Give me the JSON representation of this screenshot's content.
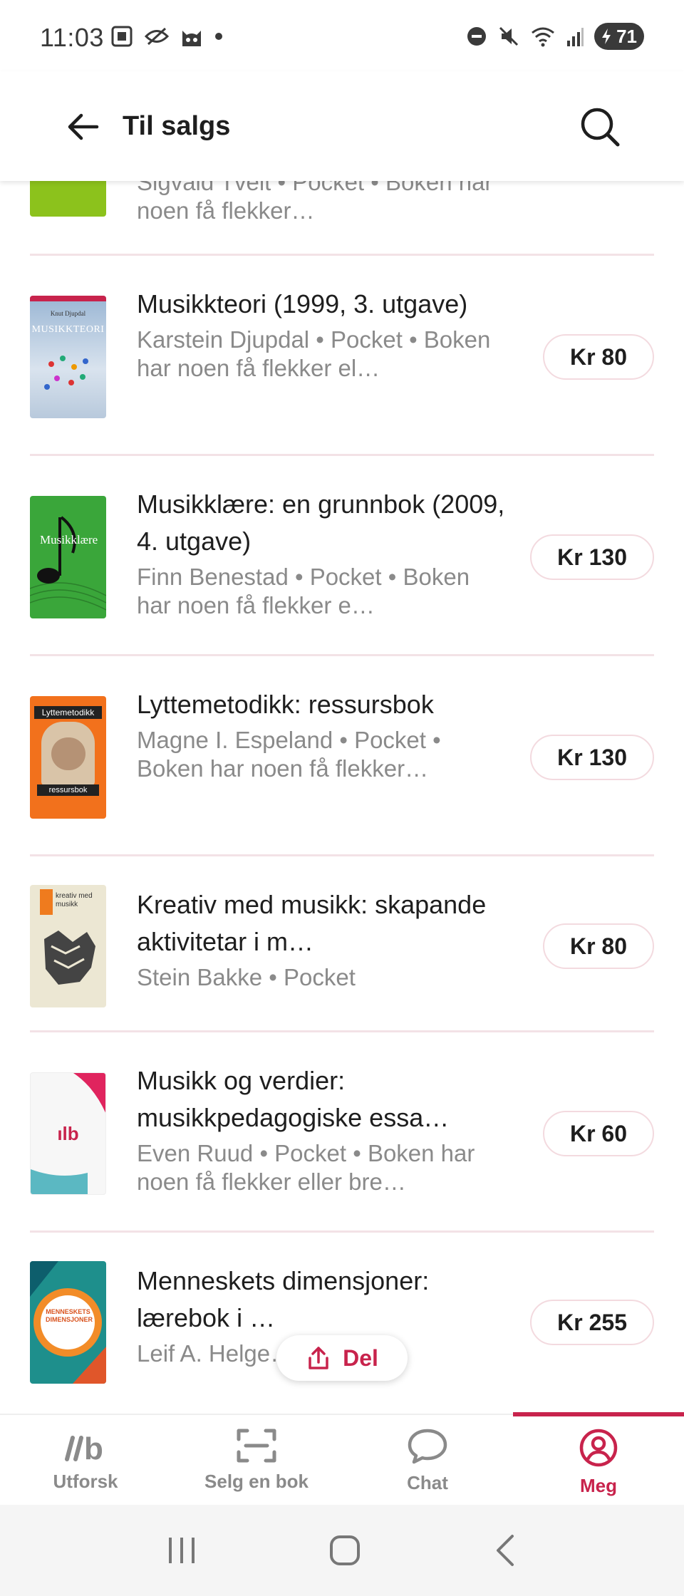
{
  "status_bar": {
    "time": "11:03",
    "battery": "71",
    "left_icons": [
      "screenshot-icon",
      "eye-off-icon",
      "cat-icon",
      "dot-icon"
    ],
    "right_icons": [
      "do-not-disturb-icon",
      "mute-icon",
      "wifi-icon",
      "signal-icon",
      "battery-icon"
    ]
  },
  "header": {
    "title": "Til salgs"
  },
  "colors": {
    "accent": "#c8234c",
    "divider": "#f3e2e6",
    "muted_text": "#8a8a8a"
  },
  "books": [
    {
      "title": "",
      "subtitle": "Sigvald Tveit • Pocket • Boken har noen få flekker…",
      "price": "",
      "cover_color": "#8cc21c"
    },
    {
      "title": "Musikkteori (1999, 3. utgave)",
      "subtitle": "Karstein Djupdal • Pocket • Boken har noen få flekker el…",
      "price": "Kr 80",
      "cover_color": "#c9d6e3",
      "cover_text": "MUSIKKTEORI",
      "cover_author": "Knut Djupdal"
    },
    {
      "title": "Musikklære: en grunnbok (2009, 4. utgave)",
      "subtitle": "Finn Benestad • Pocket • Boken har noen få flekker e…",
      "price": "Kr 130",
      "cover_color": "#3aa63a",
      "cover_text": "Musikklære"
    },
    {
      "title": "Lyttemetodikk: ressursbok",
      "subtitle": "Magne I. Espeland • Pocket • Boken har noen få flekker…",
      "price": "Kr 130",
      "cover_color": "#f2711c",
      "cover_text": "Lyttemetodikk",
      "cover_text_2": "ressursbok"
    },
    {
      "title": "Kreativ med musikk: skapande aktivitetar i m…",
      "subtitle": "Stein Bakke • Pocket",
      "price": "Kr 80",
      "cover_color": "#ece7d3",
      "cover_text": "kreativ med musikk"
    },
    {
      "title": "Musikk og verdier: musikkpedagogiske essa…",
      "subtitle": "Even Ruud • Pocket • Boken har noen få flekker eller bre…",
      "price": "Kr 60",
      "cover_color": "#f7f7f7",
      "cover_text": "ılb"
    },
    {
      "title": "Menneskets dimensjoner: lærebok i …",
      "subtitle": "Leif A. Helge… • Pocket",
      "price": "Kr 255",
      "cover_color": "#1e8f8c",
      "cover_text": "MENNESKETS DIMENSJONER"
    }
  ],
  "share": {
    "label": "Del"
  },
  "bottom_nav": [
    {
      "label": "Utforsk",
      "icon": "brand-logo-icon"
    },
    {
      "label": "Selg en bok",
      "icon": "scan-icon"
    },
    {
      "label": "Chat",
      "icon": "chat-bubble-icon"
    },
    {
      "label": "Meg",
      "icon": "profile-icon",
      "active": true
    }
  ]
}
